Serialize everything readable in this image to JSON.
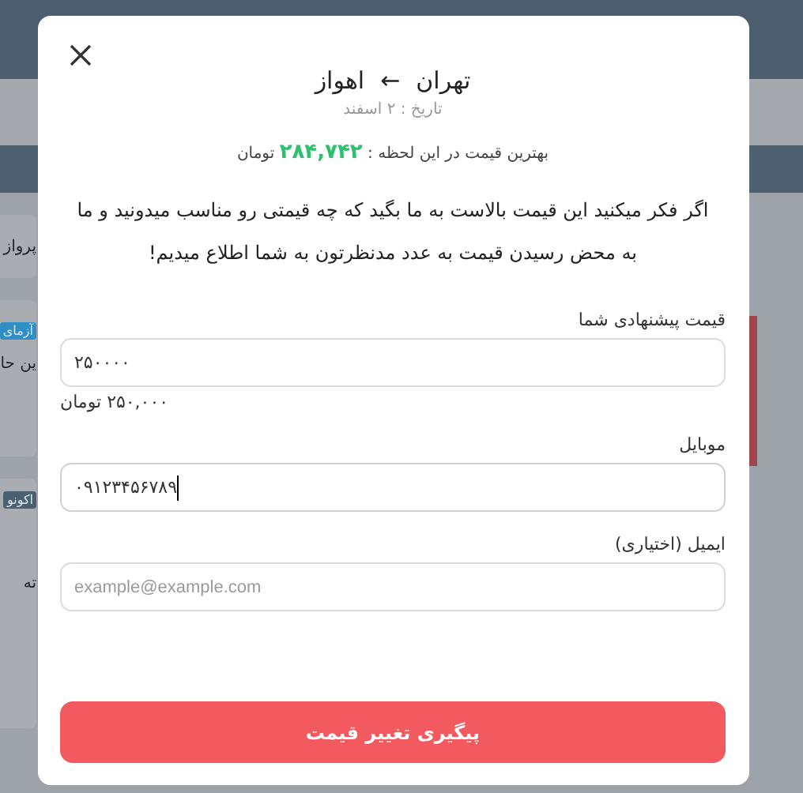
{
  "background_page": {
    "fragments": [
      "پرواز",
      "ین حا",
      "ته"
    ],
    "badges": [
      {
        "label": "آزمای",
        "color": "#2f8fc4"
      },
      {
        "label": "اکونو",
        "color": "#4a5f70"
      }
    ]
  },
  "modal": {
    "route": {
      "origin": "تهران",
      "arrow": "←",
      "destination": "اهواز"
    },
    "date": "تاریخ : ۲ اسفند",
    "best_price": "بهترین قیمت در این لحظه : **۲۸۴,۷۴۲** تومان",
    "message": "اگر فکر میکنید این قیمت بالاست به ما بگید که چه قیمتی رو مناسب میدونید و ما به محض رسیدن قیمت به عدد مدنظرتون به شما اطلاع میدیم!",
    "fields": [
      {
        "label": "قیمت پیشنهادی شما",
        "value": "۲۵۰۰۰۰",
        "hint": "۲۵۰,۰۰۰ تومان",
        "focused": false
      },
      {
        "label": "موبایل",
        "value": "۰۹۱۲۳۴۵۶۷۸۹",
        "focused": true
      },
      {
        "label": "ایمیل (اختیاری)",
        "placeholder": "example@example.com",
        "focused": false
      }
    ],
    "submit_button": "پیگیری تغییر قیمت"
  }
}
